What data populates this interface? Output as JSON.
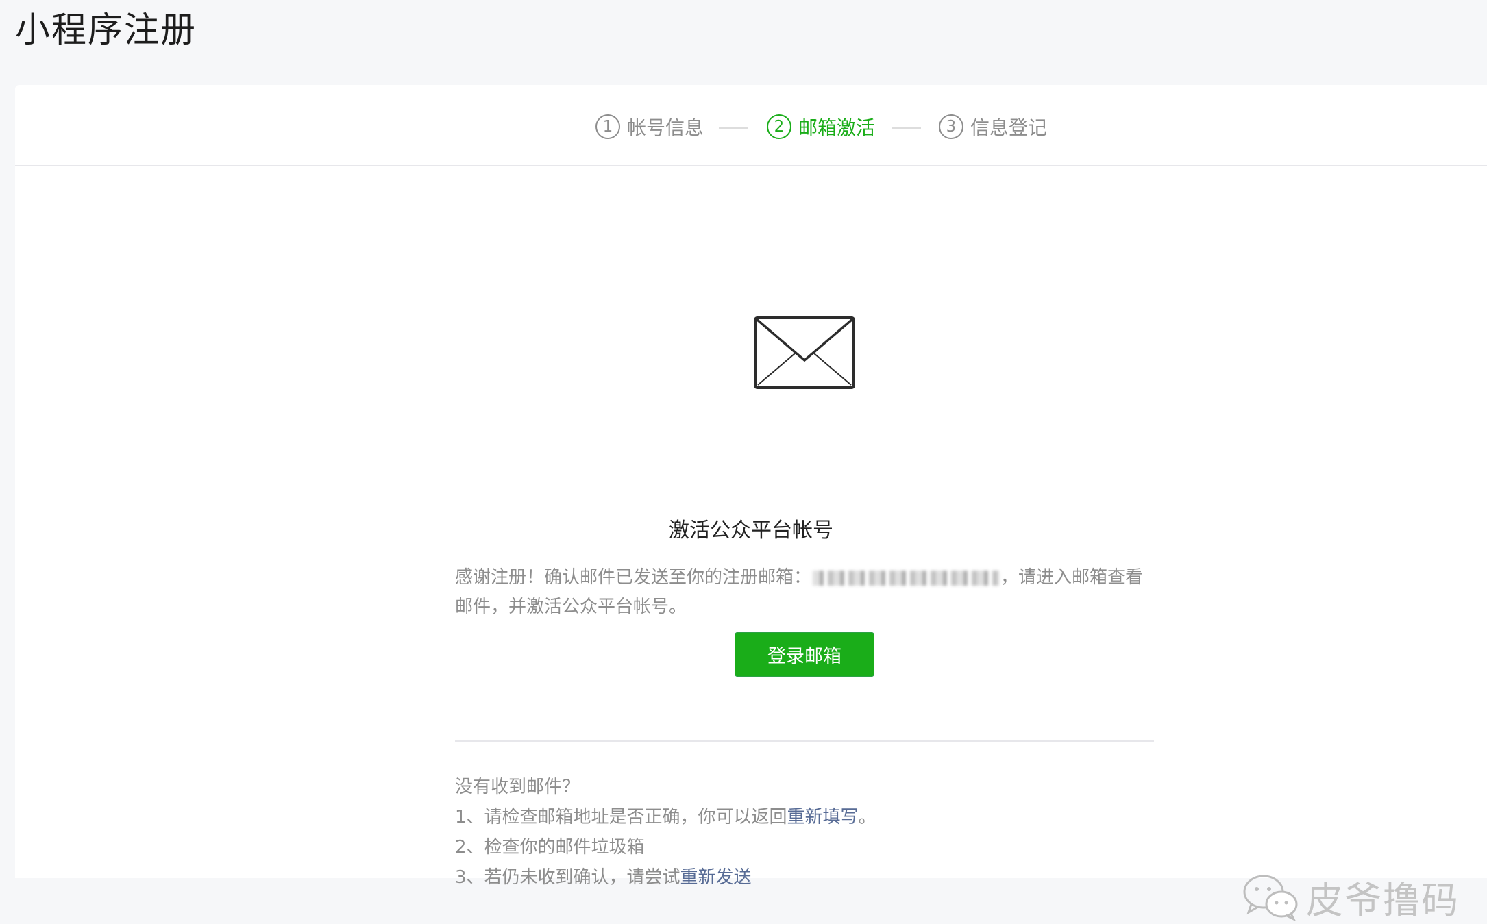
{
  "page": {
    "title": "小程序注册"
  },
  "steps": [
    {
      "num": "1",
      "label": "帐号信息",
      "active": false
    },
    {
      "num": "2",
      "label": "邮箱激活",
      "active": true
    },
    {
      "num": "3",
      "label": "信息登记",
      "active": false
    }
  ],
  "activation": {
    "icon": "envelope-icon",
    "title": "激活公众平台帐号",
    "desc_before": "感谢注册！确认邮件已发送至你的注册邮箱：",
    "desc_after": "，请进入邮箱查看邮件，并激活公众平台帐号。",
    "login_button": "登录邮箱"
  },
  "help": {
    "question": "没有收到邮件？",
    "item1_prefix": "1、请检查邮箱地址是否正确，你可以返回",
    "item1_link": "重新填写",
    "item1_suffix": "。",
    "item2": "2、检查你的邮件垃圾箱",
    "item3_prefix": "3、若仍未收到确认，请尝试",
    "item3_link": "重新发送"
  },
  "watermark": {
    "text": "皮爷撸码",
    "icon": "wechat-icon"
  },
  "colors": {
    "accent": "#1aad19",
    "link": "#576b95",
    "muted": "#8d8d8d"
  }
}
